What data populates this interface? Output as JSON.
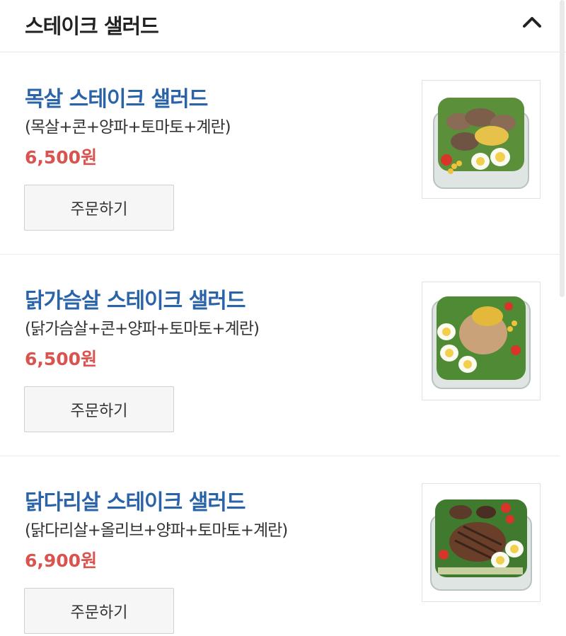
{
  "header": {
    "title": "스테이크 샐러드",
    "collapse_icon": "chevron-up-icon"
  },
  "items": [
    {
      "name": "목살 스테이크 샐러드",
      "desc": "(목살+콘+양파+토마토+계란)",
      "price": "6,500원",
      "order_label": "주문하기"
    },
    {
      "name": "닭가슴살 스테이크 샐러드",
      "desc": "(닭가슴살+콘+양파+토마토+계란)",
      "price": "6,500원",
      "order_label": "주문하기"
    },
    {
      "name": "닭다리살 스테이크 샐러드",
      "desc": "(닭다리살+올리브+양파+토마토+계란)",
      "price": "6,900원",
      "order_label": "주문하기"
    }
  ],
  "colors": {
    "name": "#2b63a8",
    "price": "#d9534f"
  }
}
